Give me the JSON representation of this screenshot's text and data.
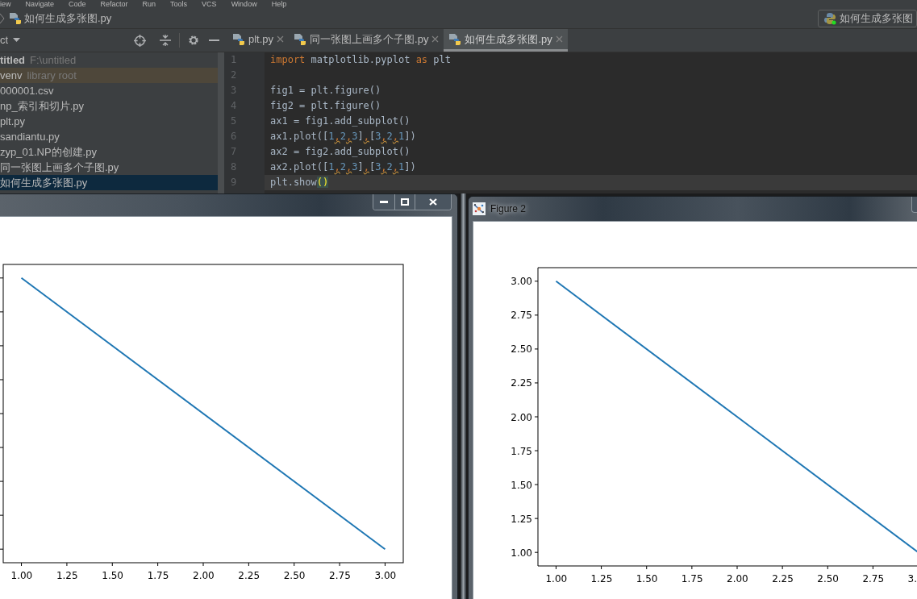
{
  "menu": [
    "iew",
    "Navigate",
    "Code",
    "Refactor",
    "Run",
    "Tools",
    "VCS",
    "Window",
    "Help"
  ],
  "breadcrumb": {
    "file": "如何生成多张图.py"
  },
  "run_config": {
    "label": "如何生成多张图"
  },
  "project_panel": {
    "title": "ct",
    "items": [
      {
        "label": "titled",
        "secondary": "F:\\untitled",
        "kind": "project",
        "marked": false,
        "selected": false
      },
      {
        "label": "venv",
        "secondary": "library root",
        "kind": "folder",
        "marked": true,
        "selected": false
      },
      {
        "label": "000001.csv",
        "kind": "file",
        "marked": false,
        "selected": false
      },
      {
        "label": "np_索引和切片.py",
        "kind": "file",
        "marked": false,
        "selected": false
      },
      {
        "label": "plt.py",
        "kind": "file",
        "marked": false,
        "selected": false
      },
      {
        "label": "sandiantu.py",
        "kind": "file",
        "marked": false,
        "selected": false
      },
      {
        "label": "zyp_01.NP的创建.py",
        "kind": "file",
        "marked": false,
        "selected": false
      },
      {
        "label": "同一张图上画多个子图.py",
        "kind": "file",
        "marked": false,
        "selected": false
      },
      {
        "label": "如何生成多张图.py",
        "kind": "file",
        "marked": false,
        "selected": true
      }
    ]
  },
  "tabs": [
    {
      "label": "plt.py",
      "selected": false
    },
    {
      "label": "同一张图上画多个子图.py",
      "selected": false
    },
    {
      "label": "如何生成多张图.py",
      "selected": true
    }
  ],
  "editor": {
    "lines": [
      {
        "number": "1",
        "current": false,
        "tokens": [
          {
            "text": "import",
            "kind": "keyword"
          },
          {
            "text": " matplotlib.pyplot ",
            "kind": "plain"
          },
          {
            "text": "as",
            "kind": "keyword"
          },
          {
            "text": " plt",
            "kind": "plain"
          }
        ]
      },
      {
        "number": "2",
        "current": false
      },
      {
        "number": "3",
        "current": false,
        "tokens": [
          {
            "text": "fig1 = plt.figure()",
            "kind": "plain"
          }
        ]
      },
      {
        "number": "4",
        "current": false,
        "tokens": [
          {
            "text": "fig2 = plt.figure()",
            "kind": "plain"
          }
        ]
      },
      {
        "number": "5",
        "current": false,
        "tokens": [
          {
            "text": "ax1 = fig1.add_subplot()",
            "kind": "plain"
          }
        ]
      },
      {
        "number": "6",
        "current": false,
        "tokens": [
          {
            "text": "ax1.plot([",
            "kind": "plain"
          },
          {
            "text": "1",
            "kind": "number"
          },
          {
            "text": ",",
            "kind": "warning"
          },
          {
            "text": "2",
            "kind": "number"
          },
          {
            "text": ",",
            "kind": "warning"
          },
          {
            "text": "3",
            "kind": "number"
          },
          {
            "text": "]",
            "kind": "plain"
          },
          {
            "text": ",",
            "kind": "warning"
          },
          {
            "text": "[",
            "kind": "plain"
          },
          {
            "text": "3",
            "kind": "number"
          },
          {
            "text": ",",
            "kind": "warning"
          },
          {
            "text": "2",
            "kind": "number"
          },
          {
            "text": ",",
            "kind": "warning"
          },
          {
            "text": "1",
            "kind": "number"
          },
          {
            "text": "])",
            "kind": "plain"
          }
        ]
      },
      {
        "number": "7",
        "current": false,
        "tokens": [
          {
            "text": "ax2 = fig2.add_subplot()",
            "kind": "plain"
          }
        ]
      },
      {
        "number": "8",
        "current": false,
        "tokens": [
          {
            "text": "ax2.plot([",
            "kind": "plain"
          },
          {
            "text": "1",
            "kind": "number"
          },
          {
            "text": ",",
            "kind": "warning"
          },
          {
            "text": "2",
            "kind": "number"
          },
          {
            "text": ",",
            "kind": "warning"
          },
          {
            "text": "3",
            "kind": "number"
          },
          {
            "text": "]",
            "kind": "plain"
          },
          {
            "text": ",",
            "kind": "warning"
          },
          {
            "text": "[",
            "kind": "plain"
          },
          {
            "text": "3",
            "kind": "number"
          },
          {
            "text": ",",
            "kind": "warning"
          },
          {
            "text": "2",
            "kind": "number"
          },
          {
            "text": ",",
            "kind": "warning"
          },
          {
            "text": "1",
            "kind": "number"
          },
          {
            "text": "])",
            "kind": "plain"
          }
        ]
      },
      {
        "number": "9",
        "current": true,
        "tokens": [
          {
            "text": "plt.show",
            "kind": "plain"
          },
          {
            "text": "()",
            "kind": "brace_match"
          }
        ]
      }
    ]
  },
  "figure_1": {
    "x_tick_labels": [
      "1.00",
      "1.25",
      "1.50",
      "1.75",
      "2.00",
      "2.25",
      "2.50",
      "2.75",
      "3.00"
    ]
  },
  "figure_2": {
    "title": "Figure 2",
    "chart_data": {
      "type": "line",
      "x": [
        1,
        2,
        3
      ],
      "series": [
        {
          "color": "#1f77b4",
          "values": [
            3,
            2,
            1
          ]
        }
      ],
      "xlim": [
        0.9,
        3.1
      ],
      "ylim": [
        0.9,
        3.1
      ],
      "xticks": [
        {
          "value": 1,
          "label": "1.00"
        },
        {
          "value": 1.25,
          "label": "1.25"
        },
        {
          "value": 1.5,
          "label": "1.50"
        },
        {
          "value": 1.75,
          "label": "1.75"
        },
        {
          "value": 2,
          "label": "2.00"
        },
        {
          "value": 2.25,
          "label": "2.25"
        },
        {
          "value": 2.5,
          "label": "2.50"
        },
        {
          "value": 2.75,
          "label": "2.75"
        },
        {
          "value": 3,
          "label": "3."
        }
      ],
      "yticks": [
        {
          "value": 1,
          "label": "1.00"
        },
        {
          "value": 1.25,
          "label": "1.25"
        },
        {
          "value": 1.5,
          "label": "1.50"
        },
        {
          "value": 1.75,
          "label": "1.75"
        },
        {
          "value": 2,
          "label": "2.00"
        },
        {
          "value": 2.25,
          "label": "2.25"
        },
        {
          "value": 2.5,
          "label": "2.50"
        },
        {
          "value": 2.75,
          "label": "2.75"
        },
        {
          "value": 3,
          "label": "3.00"
        }
      ]
    }
  }
}
